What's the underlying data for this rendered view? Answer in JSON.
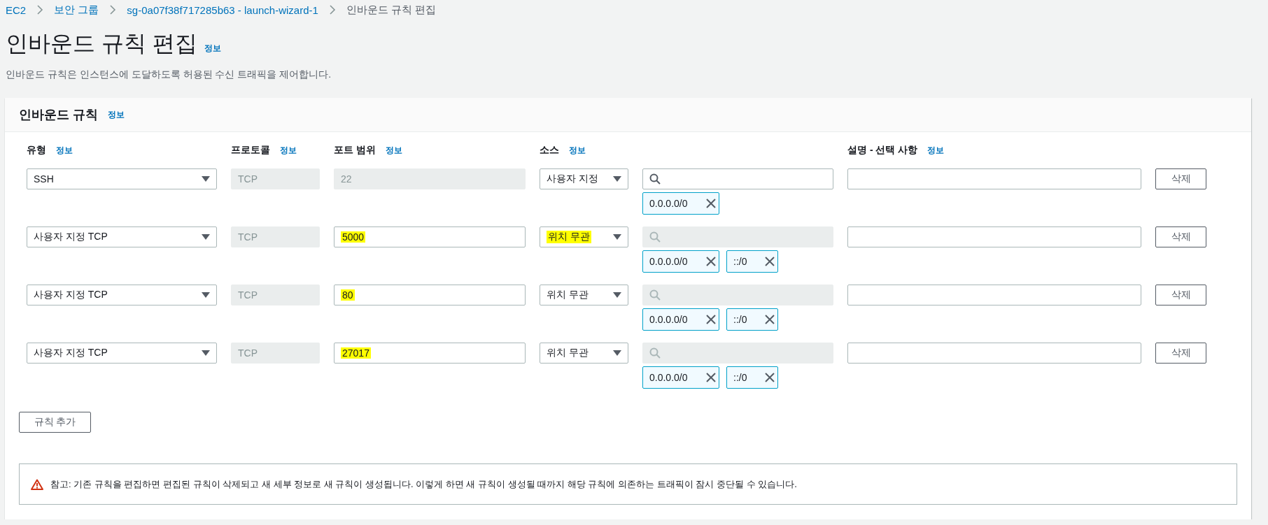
{
  "breadcrumb": [
    {
      "label": "EC2",
      "link": true
    },
    {
      "label": "보안 그룹",
      "link": true
    },
    {
      "label": "sg-0a07f38f717285b63 - launch-wizard-1",
      "link": true
    },
    {
      "label": "인바운드 규칙 편집",
      "link": false
    }
  ],
  "page": {
    "title": "인바운드 규칙 편집",
    "info": "정보",
    "description": "인바운드 규칙은 인스턴스에 도달하도록 허용된 수신 트래픽을 제어합니다."
  },
  "panel": {
    "title": "인바운드 규칙",
    "info": "정보",
    "columns": [
      {
        "label": "유형",
        "info": "정보"
      },
      {
        "label": "프로토콜",
        "info": "정보"
      },
      {
        "label": "포트 범위",
        "info": "정보"
      },
      {
        "label": "소스",
        "info": "정보"
      },
      {
        "label": "설명 - 선택 사항",
        "info": "정보"
      }
    ],
    "rules": [
      {
        "type": "SSH",
        "protocol": "TCP",
        "port": "22",
        "port_disabled": true,
        "port_highlighted": false,
        "source": "사용자 지정",
        "source_highlighted": false,
        "search_disabled": false,
        "cidrs": [
          "0.0.0.0/0"
        ],
        "delete": "삭제"
      },
      {
        "type": "사용자 지정 TCP",
        "protocol": "TCP",
        "port": "5000",
        "port_disabled": false,
        "port_highlighted": true,
        "source": "위치 무관",
        "source_highlighted": true,
        "search_disabled": true,
        "cidrs": [
          "0.0.0.0/0",
          "::/0"
        ],
        "delete": "삭제"
      },
      {
        "type": "사용자 지정 TCP",
        "protocol": "TCP",
        "port": "80",
        "port_disabled": false,
        "port_highlighted": true,
        "source": "위치 무관",
        "source_highlighted": false,
        "search_disabled": true,
        "cidrs": [
          "0.0.0.0/0",
          "::/0"
        ],
        "delete": "삭제"
      },
      {
        "type": "사용자 지정 TCP",
        "protocol": "TCP",
        "port": "27017",
        "port_disabled": false,
        "port_highlighted": true,
        "source": "위치 무관",
        "source_highlighted": false,
        "search_disabled": true,
        "cidrs": [
          "0.0.0.0/0",
          "::/0"
        ],
        "delete": "삭제"
      }
    ],
    "add_button": "규칙 추가",
    "notice": "참고: 기존 규칙을 편집하면 편집된 규칙이 삭제되고 새 세부 정보로 새 규칙이 생성됩니다. 이렇게 하면 새 규칙이 생성될 때까지 해당 규칙에 의존하는 트래픽이 잠시 중단될 수 있습니다."
  }
}
